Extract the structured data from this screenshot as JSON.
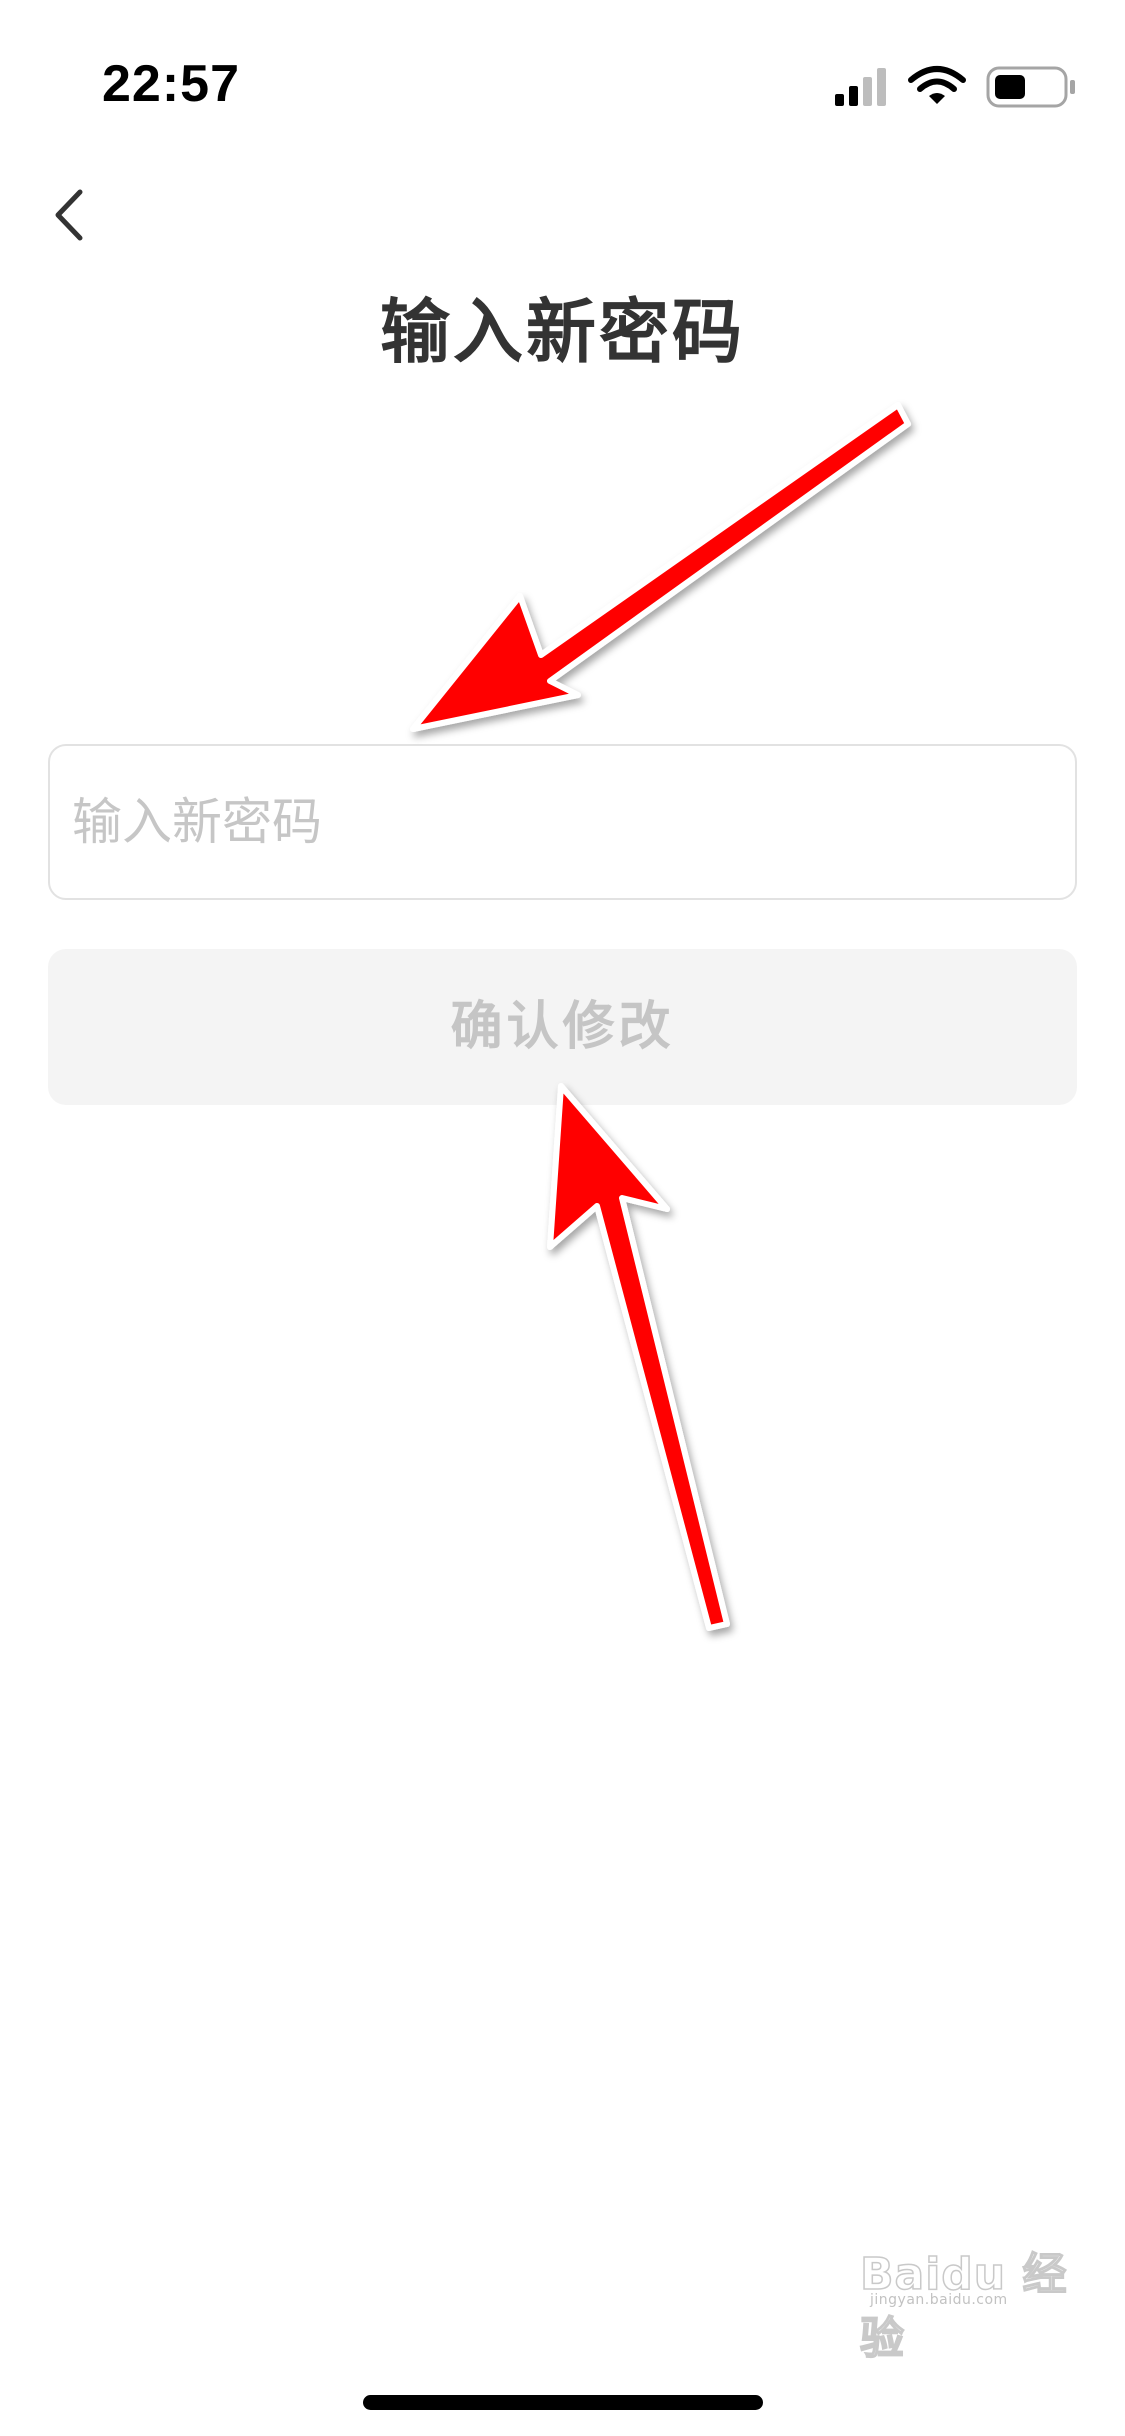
{
  "status_bar": {
    "time": "22:57",
    "signal_icon": "cellular-signal-icon",
    "wifi_icon": "wifi-icon",
    "battery_icon": "battery-icon"
  },
  "nav": {
    "back_icon": "chevron-left-icon"
  },
  "page": {
    "title": "输入新密码"
  },
  "form": {
    "password_placeholder": "输入新密码",
    "password_value": "",
    "confirm_label": "确认修改"
  },
  "watermark": {
    "logo_text": "Baidu 经验",
    "sub_text": "jingyan.baidu.com"
  },
  "colors": {
    "background": "#ffffff",
    "title_text": "#333333",
    "placeholder_text": "#c6c6c6",
    "input_border": "#e2e2e2",
    "button_disabled_bg": "#f4f4f4",
    "button_disabled_text": "#c5c5c5",
    "annotation_arrow": "#ff0000"
  }
}
